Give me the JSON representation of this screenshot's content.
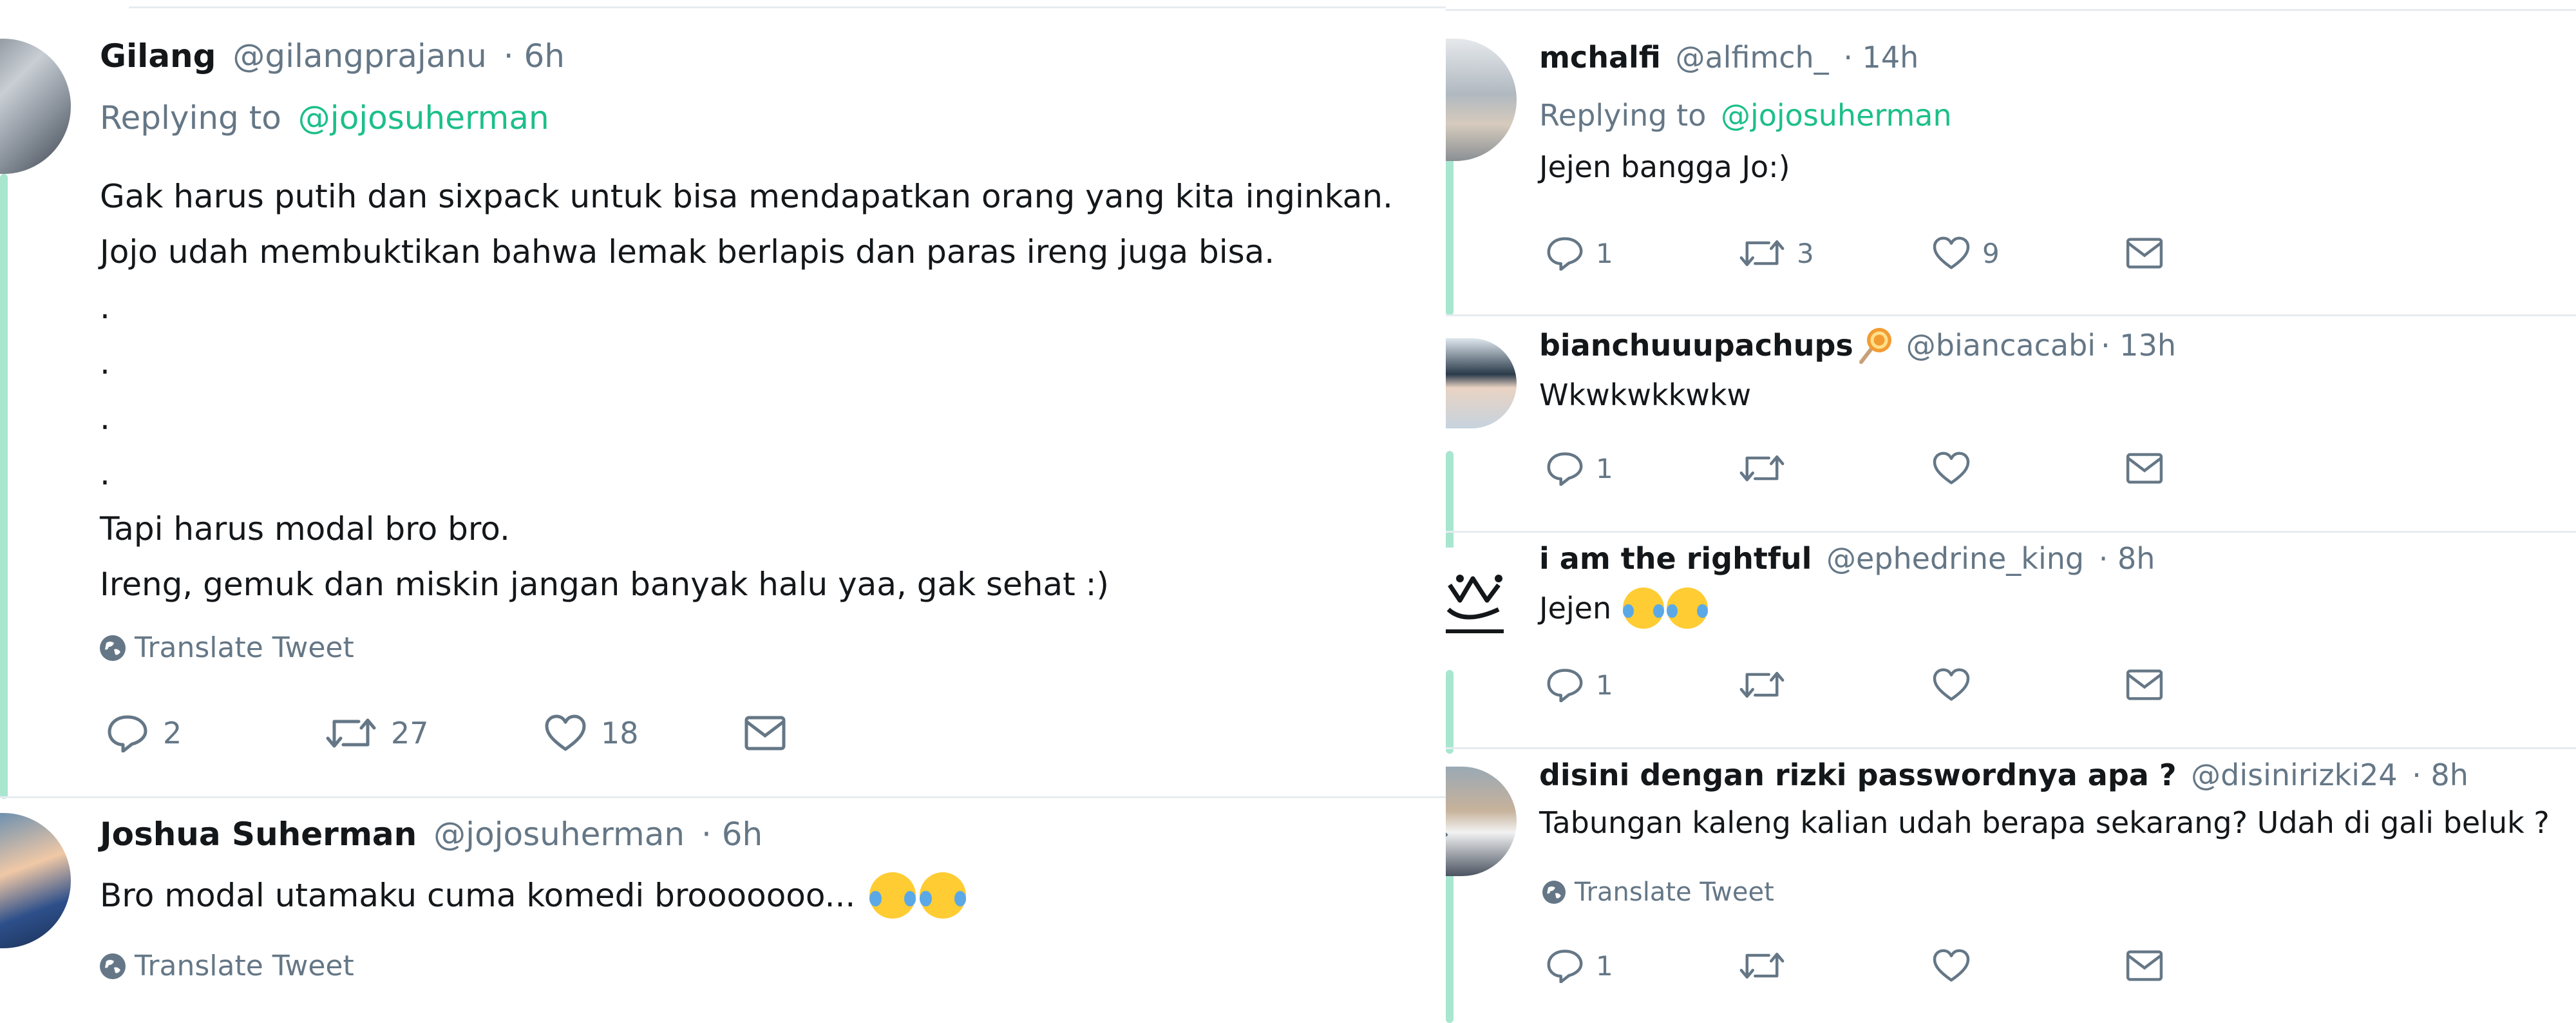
{
  "left": {
    "tweet1": {
      "name": "Gilang",
      "handle": "@gilangprajanu",
      "time": "· 6h",
      "replying_prefix": "Replying to",
      "replying_handle": "@jojosuherman",
      "lines": [
        "Gak harus putih dan sixpack untuk bisa mendapatkan orang yang kita inginkan.",
        "Jojo udah membuktikan bahwa lemak berlapis dan paras ireng juga bisa.",
        ".",
        ".",
        ".",
        ".",
        "Tapi harus modal bro bro.",
        "Ireng, gemuk dan miskin jangan banyak halu yaa, gak sehat :)"
      ],
      "translate": "Translate Tweet",
      "replies": "2",
      "retweets": "27",
      "likes": "18"
    },
    "tweet2": {
      "name": "Joshua Suherman",
      "handle": "@jojosuherman",
      "time": "· 6h",
      "text": "Bro modal utamaku cuma komedi brooooooo...",
      "translate": "Translate Tweet"
    }
  },
  "right": {
    "tweets": [
      {
        "name": "mchalfi",
        "handle": "@alfimch_",
        "time": "· 14h",
        "replying_prefix": "Replying to",
        "replying_handle": "@jojosuherman",
        "text": "Jejen bangga Jo:)",
        "replies": "1",
        "retweets": "3",
        "likes": "9"
      },
      {
        "name": "bianchuuupachups",
        "handle": "@biancacabi",
        "time": "· 13h",
        "text": "Wkwkwkkwkw",
        "replies": "1",
        "retweets": "",
        "likes": ""
      },
      {
        "name": "i am the rightful",
        "handle": "@ephedrine_king",
        "time": "· 8h",
        "text": "Jejen",
        "replies": "1",
        "retweets": "",
        "likes": ""
      },
      {
        "name": "disini dengan rizki passwordnya apa ?",
        "handle": "@disinirizki24",
        "time": "· 8h",
        "text": "Tabungan kaleng kalian udah berapa sekarang? Udah di gali beluk ?",
        "translate": "Translate Tweet",
        "replies": "1",
        "retweets": "",
        "likes": ""
      }
    ]
  },
  "icons": {
    "reply": "reply-icon",
    "retweet": "retweet-icon",
    "like": "heart-icon",
    "dm": "envelope-icon",
    "globe": "globe-icon"
  },
  "colors": {
    "accent": "#1dbf8a",
    "thread": "#a8e6cf",
    "muted": "#657786",
    "text": "#14171a"
  }
}
